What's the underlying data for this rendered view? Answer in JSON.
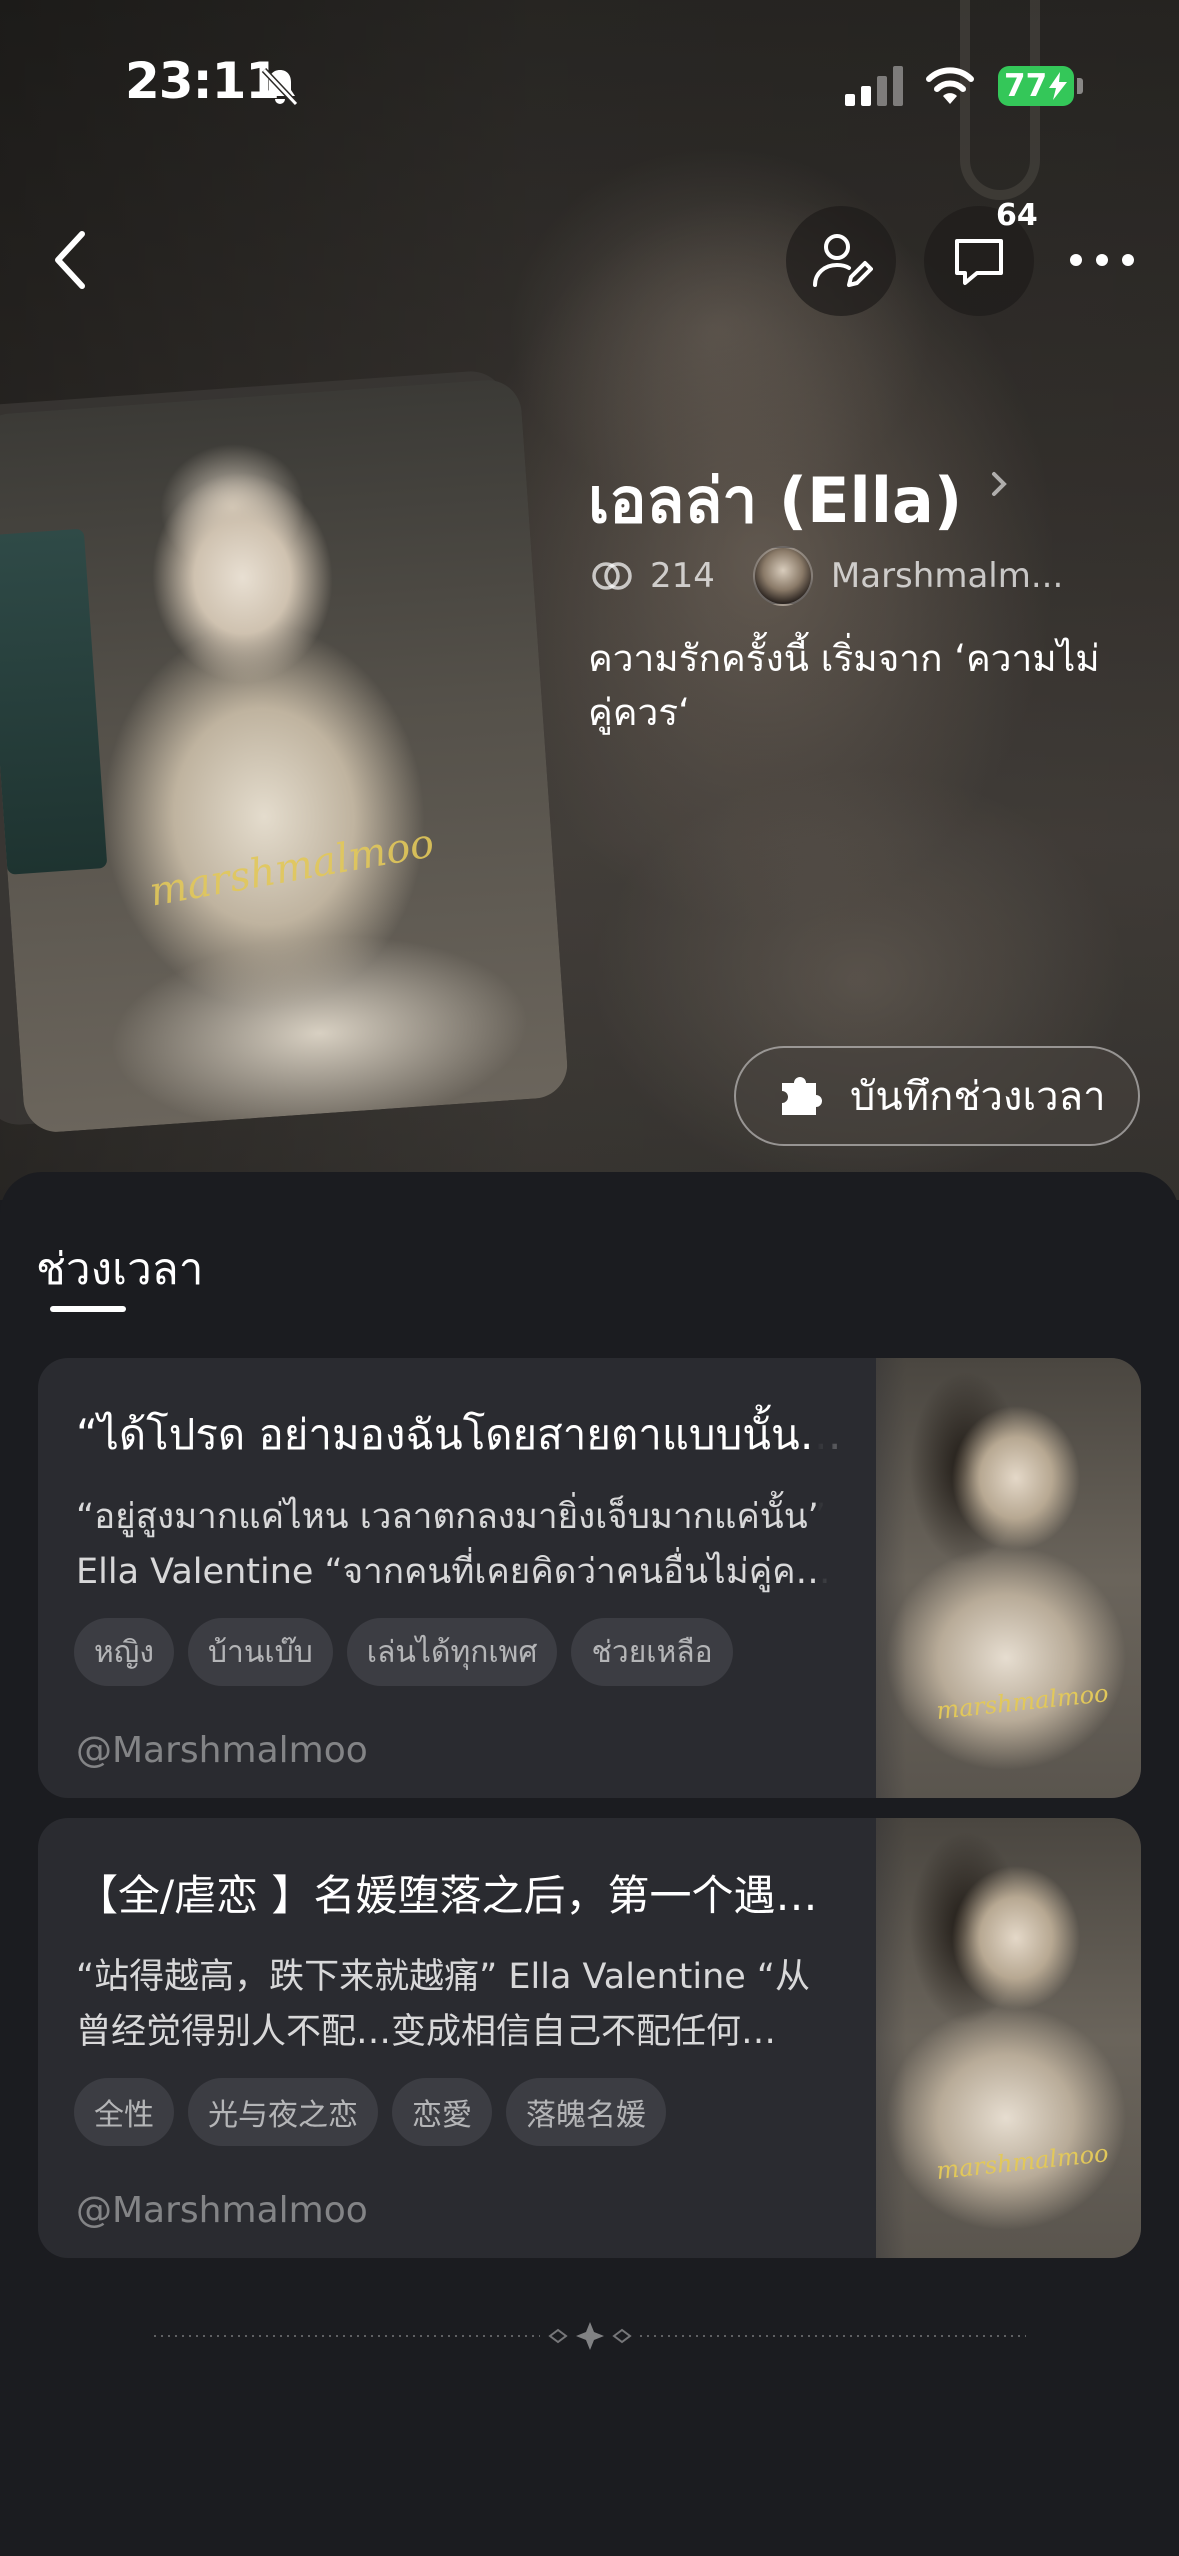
{
  "status_bar": {
    "time": "23:11",
    "battery": "77"
  },
  "header": {
    "comment_count": "64"
  },
  "character": {
    "name": "เอลล่า (Ella)",
    "link_count": "214",
    "creator_short": "Marshmalm...",
    "description": "ความรักครั้งนี้ เริ่มจาก ‘ความไม่คู่ควร‘",
    "card_watermark": "marshmalmoo"
  },
  "save_moment_label": "บันทึกช่วงเวลา",
  "section": {
    "title": "ช่วงเวลา"
  },
  "stories": [
    {
      "title": "“ได้โปรด อย่ามองฉันโดยสายตาแบบนั้น…",
      "line1": "“อยู่สูงมากแค่ไหน เวลาตกลงมายิ่งเจ็บมากแค่นั้น”",
      "line2": "Ella Valentine “จากคนที่เคยคิดว่าคนอื่นไม่คู่ค…",
      "tags": [
        "หญิง",
        "บ้านเบ๊บ",
        "เล่นได้ทุกเพศ",
        "ช่วยเหลือ"
      ],
      "author": "@Marshmalmoo",
      "thumb_watermark": "marshmalmoo"
    },
    {
      "title": "【全/虐恋 】名媛堕落之后，第一个遇…",
      "line1": "“站得越高，跌下来就越痛” Ella Valentine “从",
      "line2": "曾经觉得别人不配…变成相信自己不配任何…",
      "tags": [
        "全性",
        "光与夜之恋",
        "恋愛",
        "落魄名媛"
      ],
      "author": "@Marshmalmoo",
      "thumb_watermark": "marshmalmoo"
    }
  ],
  "colors": {
    "battery": "#34c759",
    "panel": "#1b1c20",
    "card": "#2a2b30",
    "watermark": "#e2c85a"
  }
}
